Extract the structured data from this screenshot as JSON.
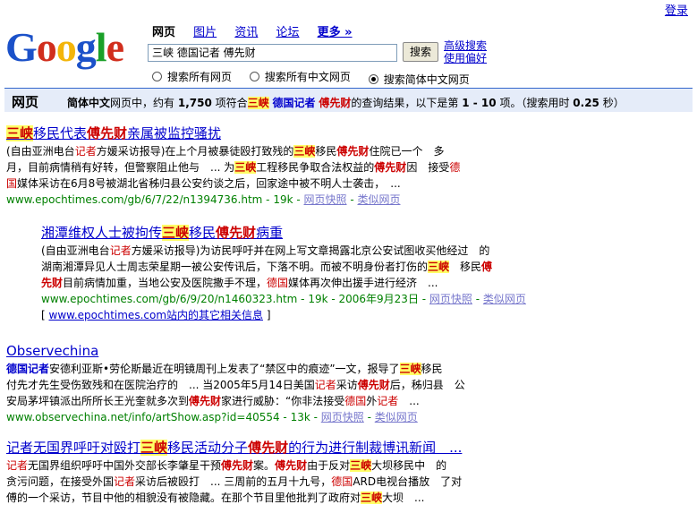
{
  "header": {
    "login": "登录",
    "logo_letters": [
      "G",
      "o",
      "o",
      "g",
      "l",
      "e"
    ],
    "logo_colors": [
      "#1b51c9",
      "#d12e1d",
      "#f3b50a",
      "#1b51c9",
      "#1aa028",
      "#d12e1d"
    ],
    "tabs": [
      "网页",
      "图片",
      "资讯",
      "论坛",
      "更多 »"
    ],
    "query": "三峡  德国记者  傅先财",
    "search_button": "搜索",
    "advanced_search": "高级搜索",
    "preferences": "使用偏好",
    "radios": [
      "搜索所有网页",
      "搜索所有中文网页",
      "搜索简体中文网页"
    ],
    "radio_selected": 2
  },
  "status_bar": {
    "label": "网页",
    "lang": "简体中文",
    "t1": "网页中，约有",
    "count": "1,750",
    "t2": "项符合",
    "k1": "三峡",
    "k2": "德国记者",
    "k3": "傅先财",
    "t3": "的查询结果，以下是第",
    "range": "1 - 10",
    "t4": "项。（搜索用时",
    "time": "0.25",
    "t5": "秒）"
  },
  "results": [
    {
      "title_parts": [
        "三峡",
        "移民代表",
        "傅先财",
        "亲属被监控骚扰"
      ],
      "snippet_html": "(自由亚洲电台<span class=\"red\">记者</span>方媛采访报导)在上个月被暴徒殴打致残的<span class=\"hl\">三峡</span>移民<span class=\"hlk\">傅先财</span>住院已一个　多<br>月，目前病情稍有好转，但警察阻止他与　... 为<span class=\"hl\">三峡</span>工程移民争取合法权益的<span class=\"hlk\">傅先财</span>因　接受<span class=\"red\">德</span><br><span class=\"red\">国</span>媒体采访在6月8号被湖北省秭归县公安约谈之后，回家途中被不明人士袭击，　...",
      "url": "www.epochtimes.com/gb/6/7/22/n1394736.htm - 19k - ",
      "cache": "网页快照",
      "similar": "类似网页"
    },
    {
      "title_parts": [
        "湘潭维权人士被拘传",
        "三峡",
        "移民",
        "傅先财",
        "病重"
      ],
      "snippet_html": "(自由亚洲电台<span class=\"red\">记者</span>方媛采访报导)为访民呼吁并在网上写文章揭露北京公安试图收买他经过　的<br>湖南湘潭异见人士周志荣星期一被公安传讯后，下落不明。而被不明身份者打伤的<span class=\"hl\">三峡</span>　移民<span class=\"hlk\">傅</span><br><span class=\"hlk\">先财</span>目前病情加重，当地公安及医院撒手不理，<span class=\"red\">德国</span>媒体再次伸出援手进行经济　...",
      "url": "www.epochtimes.com/gb/6/9/20/n1460323.htm - 19k - 2006年9月23日 - ",
      "cache": "网页快照",
      "similar": "类似网页",
      "more_site": "www.epochtimes.com站内的其它相关信息"
    },
    {
      "title_parts": [
        "Observechina"
      ],
      "snippet_html": "<span class=\"hlb\">德国记者</span>安德利亚斯•劳伦斯最近在明镜周刊上发表了“禁区中的痕迹”一文，报导了<span class=\"hl\">三峡</span>移民<br>付先才先生受伤致残和在医院治疗的　... 当2005年5月14日美国<span class=\"red\">记者</span>采访<span class=\"hlk\">傅先财</span>后，秭归县　公<br>安局茅坪镇派出所所长王光奎就多次到<span class=\"hlk\">傅先财</span>家进行威胁：“你非法接受<span class=\"red\">德国</span>外<span class=\"red\">记者</span>　...",
      "url": "www.observechina.net/info/artShow.asp?id=40554 - 13k - ",
      "cache": "网页快照",
      "similar": "类似网页"
    },
    {
      "title_parts": [
        "记者",
        "无国界呼吁对殴打",
        "三峡",
        "移民活动分子",
        "傅先财",
        "的行为进行制裁博讯新闻　..."
      ],
      "snippet_html": "<span class=\"red\">记者</span>无国界组织呼吁中国外交部长李肇星干预<span class=\"hlk\">傅先财</span>案。<span class=\"hlk\">傅先财</span>由于反对<span class=\"hl\">三峡</span>大坝移民中　的<br>贪污问题，在接受外国<span class=\"red\">记者</span>采访后被殴打　... 三周前的五月十九号，<span class=\"red\">德国</span>ARD电视台播放　了对<br>傅的一个采访，节目中他的相貌没有被隐藏。在那个节目里他批判了政府对<span class=\"hl\">三峡</span>大坝　..."
    }
  ]
}
